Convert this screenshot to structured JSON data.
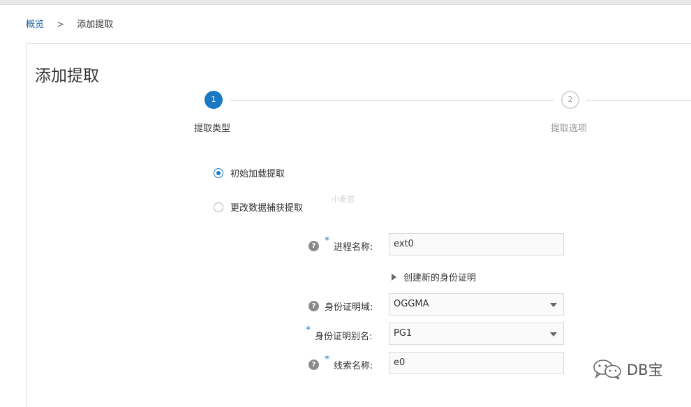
{
  "breadcrumb": {
    "root": "概览",
    "separator": ">",
    "current": "添加提取"
  },
  "page": {
    "title": "添加提取"
  },
  "stepper": {
    "steps": [
      {
        "number": "1",
        "label": "提取类型",
        "state": "active"
      },
      {
        "number": "2",
        "label": "提取选项",
        "state": "inactive"
      }
    ]
  },
  "extract_type": {
    "options": [
      {
        "label": "初始加载提取",
        "checked": true
      },
      {
        "label": "更改数据捕获提取",
        "checked": false
      }
    ]
  },
  "watermark": "小麦苗",
  "form": {
    "process_name": {
      "label": "进程名称:",
      "value": "ext0",
      "required": true
    },
    "create_credential": {
      "label": "创建新的身份证明"
    },
    "credential_domain": {
      "label": "身份证明域:",
      "value": "OGGMA"
    },
    "credential_alias": {
      "label": "身份证明别名:",
      "value": "PG1",
      "required": true
    },
    "trail_name": {
      "label": "线索名称:",
      "value": "e0",
      "required": true
    },
    "help_symbol": "?",
    "required_symbol": "*"
  },
  "brand": {
    "text": "DB宝"
  },
  "colors": {
    "accent": "#1a79c2",
    "link": "#1a5f9e",
    "border": "#dcdcdc"
  }
}
